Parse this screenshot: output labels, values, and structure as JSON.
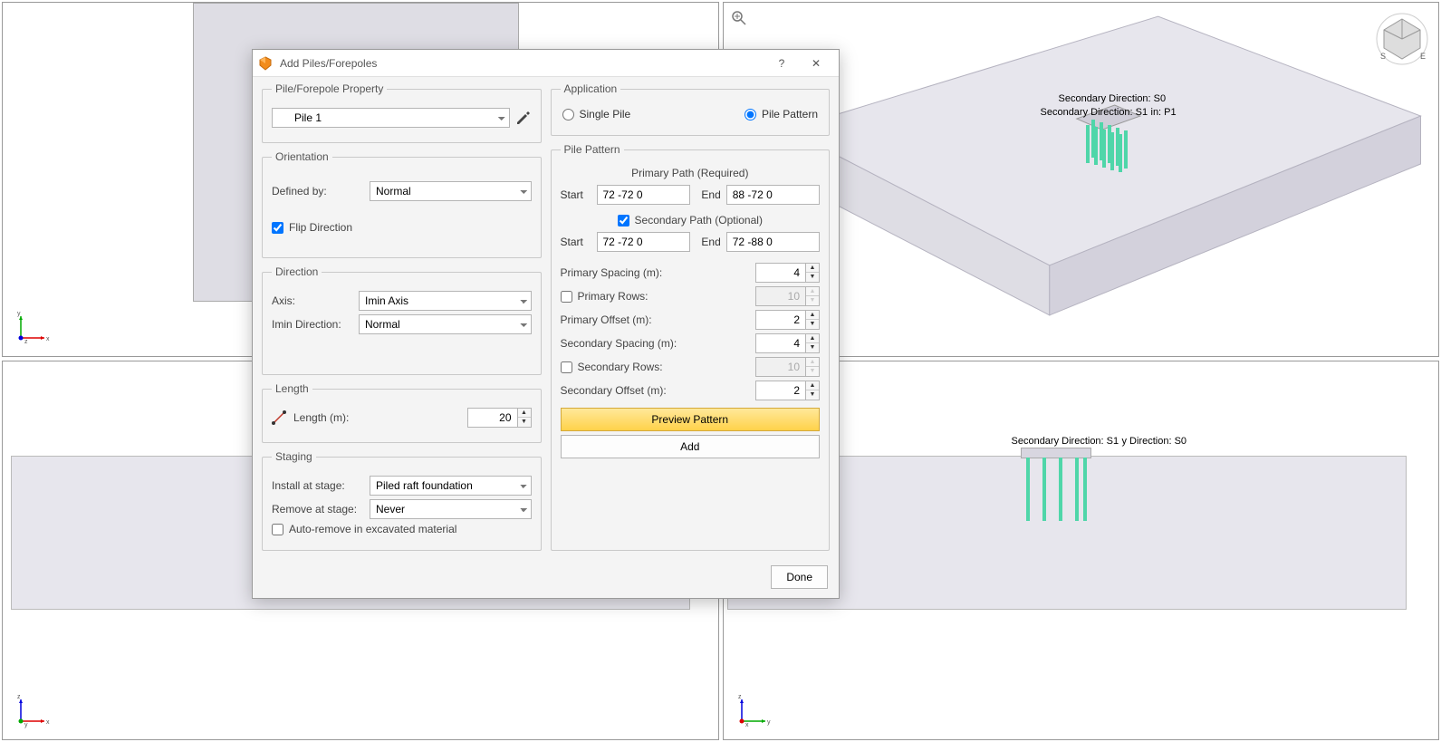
{
  "dialog": {
    "title": "Add Piles/Forepoles",
    "help_label": "?",
    "close_label": "✕",
    "done_label": "Done",
    "property": {
      "legend": "Pile/Forepole Property",
      "selected": "Pile 1"
    },
    "orientation": {
      "legend": "Orientation",
      "defined_by_label": "Defined by:",
      "defined_by_value": "Normal",
      "flip_label": "Flip Direction",
      "flip_checked": true
    },
    "direction": {
      "legend": "Direction",
      "axis_label": "Axis:",
      "axis_value": "Imin Axis",
      "imin_label": "Imin Direction:",
      "imin_value": "Normal"
    },
    "length": {
      "legend": "Length",
      "label": "Length (m):",
      "value": "20"
    },
    "staging": {
      "legend": "Staging",
      "install_label": "Install at stage:",
      "install_value": "Piled raft foundation",
      "remove_label": "Remove at stage:",
      "remove_value": "Never",
      "auto_remove_label": "Auto-remove in excavated material",
      "auto_remove_checked": false
    },
    "application": {
      "legend": "Application",
      "single_label": "Single Pile",
      "pattern_label": "Pile Pattern",
      "selected": "pattern"
    },
    "pattern": {
      "legend": "Pile Pattern",
      "primary_head": "Primary Path (Required)",
      "start_label": "Start",
      "end_label": "End",
      "primary_start": "72 -72 0",
      "primary_end": "88 -72 0",
      "secondary_head": "Secondary Path (Optional)",
      "secondary_checked": true,
      "secondary_start": "72 -72 0",
      "secondary_end": "72 -88 0",
      "primary_spacing_label": "Primary Spacing (m):",
      "primary_spacing": "4",
      "primary_rows_label": "Primary Rows:",
      "primary_rows_checked": false,
      "primary_rows": "10",
      "primary_offset_label": "Primary Offset (m):",
      "primary_offset": "2",
      "secondary_spacing_label": "Secondary Spacing (m):",
      "secondary_spacing": "4",
      "secondary_rows_label": "Secondary Rows:",
      "secondary_rows_checked": false,
      "secondary_rows": "10",
      "secondary_offset_label": "Secondary Offset (m):",
      "secondary_offset": "2",
      "preview_label": "Preview Pattern",
      "add_label": "Add"
    }
  },
  "viewports": {
    "tr_labels": {
      "l1": "Secondary Direction: S0",
      "l2": "Secondary Direction: S1",
      "l3": "in: P1"
    },
    "br_labels": {
      "l1": "Secondary Direction: S1",
      "l2": "y Direction: S0"
    },
    "axes": {
      "x": "x",
      "y": "y",
      "z": "z"
    },
    "navcube": {
      "s": "S",
      "e": "E"
    }
  }
}
